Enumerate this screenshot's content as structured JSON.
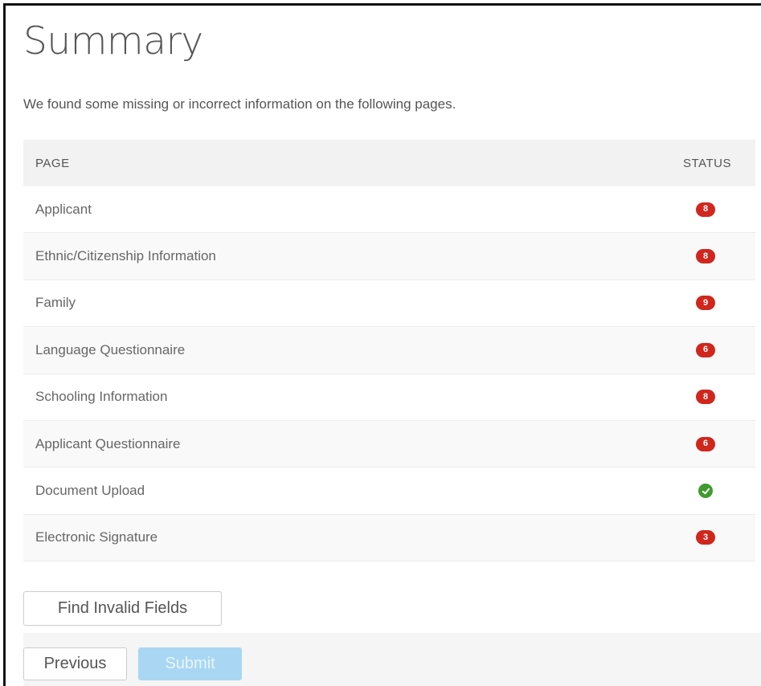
{
  "page": {
    "title": "Summary",
    "intro": "We found some missing or incorrect information on the following pages."
  },
  "table": {
    "headers": {
      "page": "PAGE",
      "status": "STATUS"
    },
    "rows": [
      {
        "page": "Applicant",
        "status_type": "error",
        "count": "8"
      },
      {
        "page": "Ethnic/Citizenship Information",
        "status_type": "error",
        "count": "8"
      },
      {
        "page": "Family",
        "status_type": "error",
        "count": "9"
      },
      {
        "page": "Language Questionnaire",
        "status_type": "error",
        "count": "6"
      },
      {
        "page": "Schooling Information",
        "status_type": "error",
        "count": "8"
      },
      {
        "page": "Applicant Questionnaire",
        "status_type": "error",
        "count": "6"
      },
      {
        "page": "Document Upload",
        "status_type": "ok",
        "icon": "check-icon"
      },
      {
        "page": "Electronic Signature",
        "status_type": "error",
        "count": "3"
      }
    ]
  },
  "buttons": {
    "find_invalid": "Find Invalid Fields",
    "previous": "Previous",
    "submit": "Submit"
  },
  "colors": {
    "error_badge": "#d0261e",
    "ok_badge": "#3e9b2f",
    "submit_disabled": "#a9d7f3"
  }
}
